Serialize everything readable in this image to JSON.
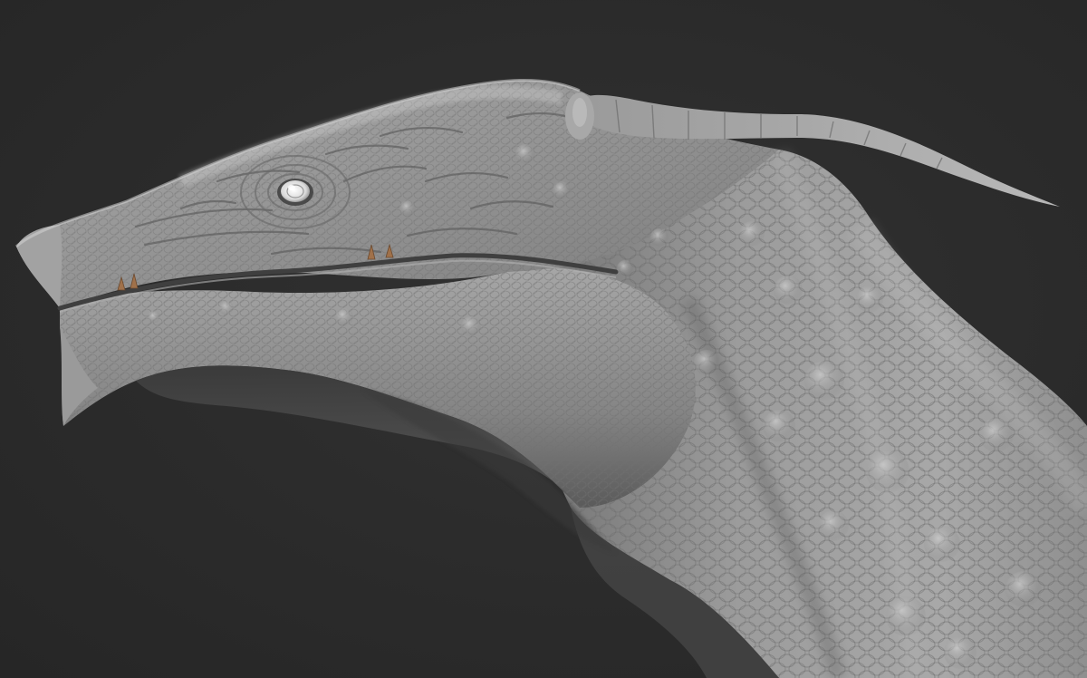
{
  "scene": {
    "subject": "creature-head-sculpt",
    "background_color": "#2a2a2a",
    "material_base_color": "#8e8e8e",
    "material_highlight_color": "#c4c4c4",
    "material_shadow_color": "#3a3a3a",
    "eye_color": "#e6e6e6",
    "tooth_color": "#a0714a"
  }
}
